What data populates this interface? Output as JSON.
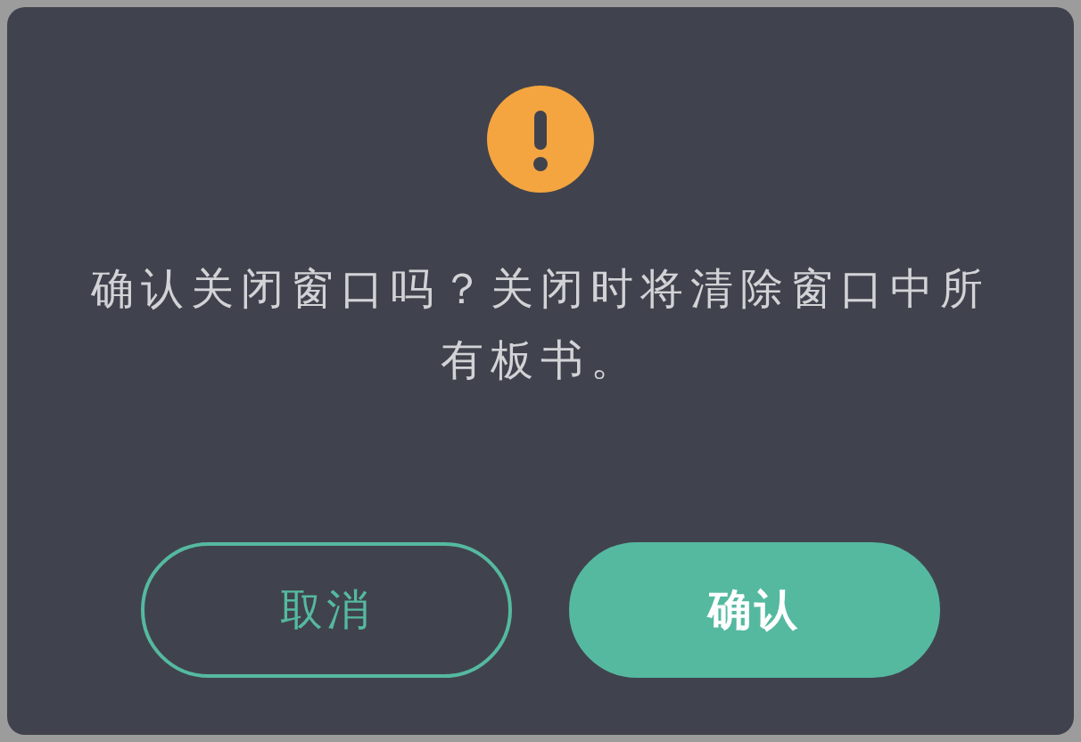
{
  "dialog": {
    "message": "确认关闭窗口吗？关闭时将清除窗口中所有板书。",
    "buttons": [
      {
        "label": "取消",
        "kind": "secondary"
      },
      {
        "label": "确认",
        "kind": "primary"
      }
    ]
  }
}
